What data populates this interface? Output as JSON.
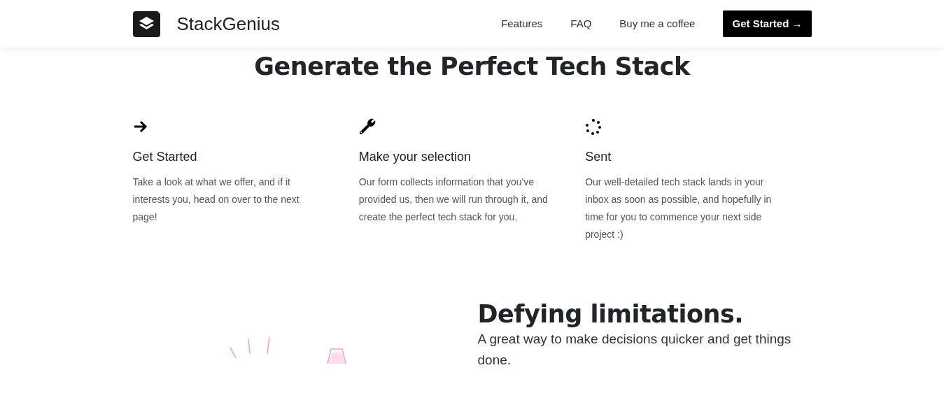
{
  "navbar": {
    "brand": "StackGenius",
    "links": [
      {
        "label": "Features"
      },
      {
        "label": "FAQ"
      },
      {
        "label": "Buy me a coffee"
      }
    ],
    "cta": "Get Started →"
  },
  "hero": {
    "title": "Generate the Perfect Tech Stack"
  },
  "features": [
    {
      "kind": "arrow",
      "title": "Get Started",
      "text": "Take a look at what we offer, and if it interests you, head on over to the next page!"
    },
    {
      "kind": "wrench",
      "title": "Make your selection",
      "text": "Our form collects information that you've provided us, then we will run through it, and create the perfect tech stack for you."
    },
    {
      "kind": "spinner",
      "title": "Sent",
      "text": "Our well-detailed tech stack lands in your inbox as soon as possible, and hopefully in time for you to commence your next side project :)"
    }
  ],
  "section": {
    "title": "Defying limitations.",
    "subtitle": "A great way to make decisions quicker and get things done."
  }
}
